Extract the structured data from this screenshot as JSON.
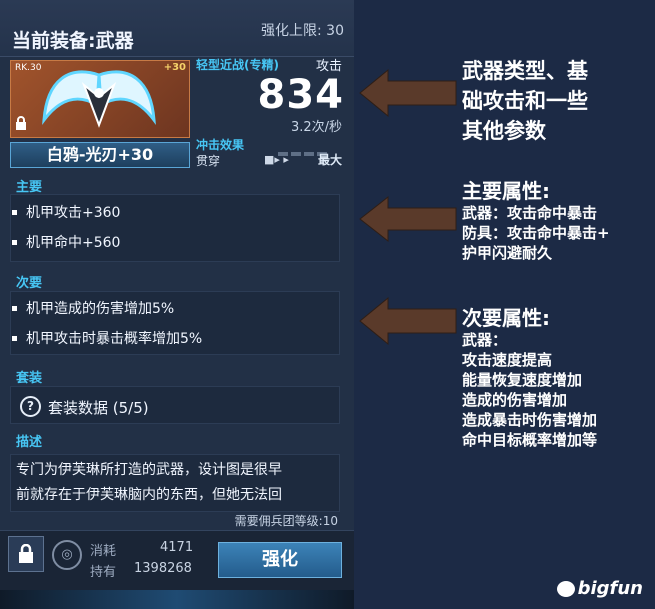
{
  "panel": {
    "title": "当前装备:武器",
    "enhance_limit": "强化上限: 30"
  },
  "weapon": {
    "rank": "RK.30",
    "plus": "+30",
    "name": "白鸦-光刃+30",
    "type": "轻型近战(专精)",
    "attack_label": "攻击",
    "attack_value": "834",
    "attack_speed": "3.2次/秒",
    "impact_label": "冲击效果",
    "pierce_label": "贯穿",
    "pierce_level": "最大"
  },
  "primary": {
    "title": "主要",
    "items": [
      "机甲攻击+360",
      "机甲命中+560"
    ]
  },
  "secondary": {
    "title": "次要",
    "items": [
      "机甲造成的伤害增加5%",
      "机甲攻击时暴击概率增加5%"
    ]
  },
  "set": {
    "title": "套装",
    "text": "套装数据 (5/5)"
  },
  "description": {
    "title": "描述",
    "lines": [
      "专门为伊芙琳所打造的武器，设计图是很早",
      "前就存在于伊芙琳脑内的东西，但她无法回"
    ],
    "required_level": "需要佣兵团等级:10"
  },
  "footer": {
    "consume_label": "消耗",
    "own_label": "持有",
    "consume_value": "4171",
    "own_value": "1398268",
    "enhance_button": "强化"
  },
  "annotations": {
    "first": [
      "武器类型、基",
      "础攻击和一些",
      "其他参数"
    ],
    "primary_title": "主要属性:",
    "primary_lines": [
      "武器：攻击命中暴击",
      "防具：攻击命中暴击+",
      "护甲闪避耐久"
    ],
    "secondary_title": "次要属性:",
    "secondary_lines": [
      "武器：",
      "攻击速度提高",
      "能量恢复速度增加",
      "造成的伤害增加",
      "造成暴击时伤害增加",
      "命中目标概率增加等"
    ]
  },
  "logo": "bigfun",
  "colors": {
    "accent": "#47c6f4",
    "background": "#1c2a45",
    "arrow": "#5a3a2a"
  },
  "icons": [
    "lock-icon",
    "help-icon",
    "coin-icon",
    "arrow-left-icon"
  ]
}
